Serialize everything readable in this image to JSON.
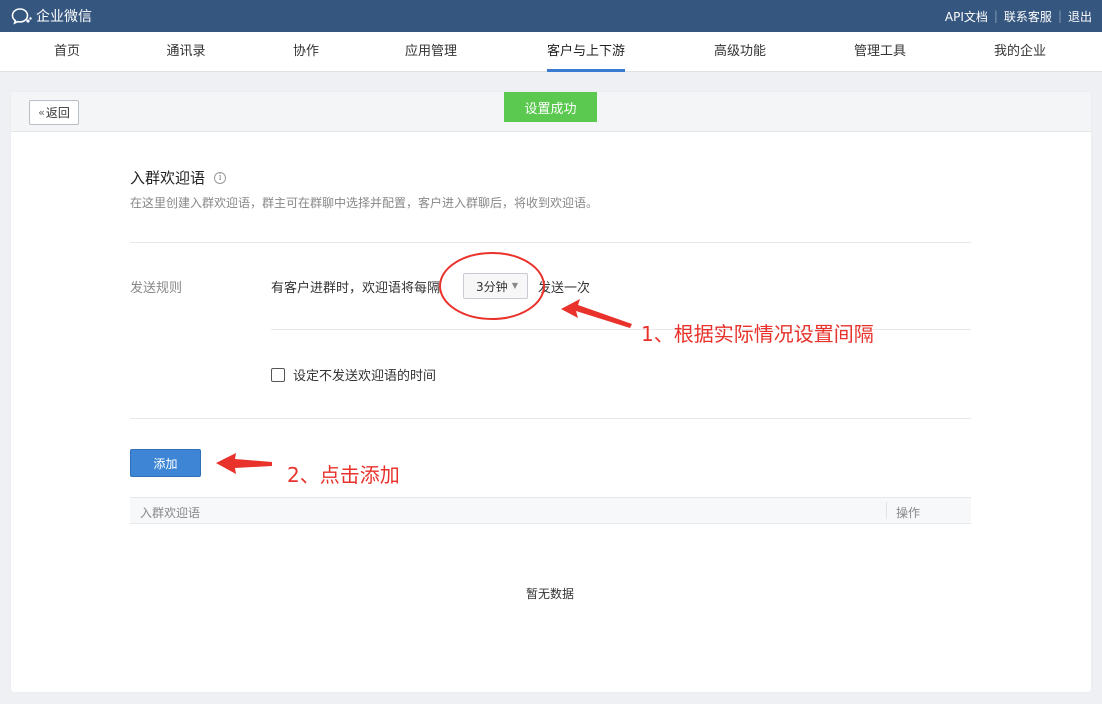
{
  "app": {
    "name": "企业微信"
  },
  "top_links": {
    "api_docs": "API文档",
    "support": "联系客服",
    "logout": "退出"
  },
  "nav": {
    "tabs": [
      {
        "label": "首页"
      },
      {
        "label": "通讯录"
      },
      {
        "label": "协作"
      },
      {
        "label": "应用管理"
      },
      {
        "label": "客户与上下游"
      },
      {
        "label": "高级功能"
      },
      {
        "label": "管理工具"
      },
      {
        "label": "我的企业"
      }
    ],
    "active_index": 4
  },
  "page": {
    "back_label": "返回",
    "toast": "设置成功",
    "title": "入群欢迎语",
    "description": "在这里创建入群欢迎语，群主可在群聊中选择并配置，客户进入群聊后，将收到欢迎语。",
    "rule_label": "发送规则",
    "rule_prefix": "有客户进群时，欢迎语将每隔",
    "interval_value": "3分钟",
    "rule_suffix": "发送一次",
    "checkbox_label": "设定不发送欢迎语的时间",
    "checkbox_checked": false,
    "add_label": "添加",
    "table": {
      "columns": [
        "入群欢迎语",
        "操作"
      ],
      "empty_text": "暂无数据"
    }
  },
  "annotations": {
    "step1": "1、根据实际情况设置间隔",
    "step2": "2、点击添加",
    "color": "#e8322b"
  },
  "colors": {
    "topbar": "#35567f",
    "primary": "#3e86d5",
    "toast": "#5bc94f",
    "nav_active_underline": "#3a7ad1"
  }
}
